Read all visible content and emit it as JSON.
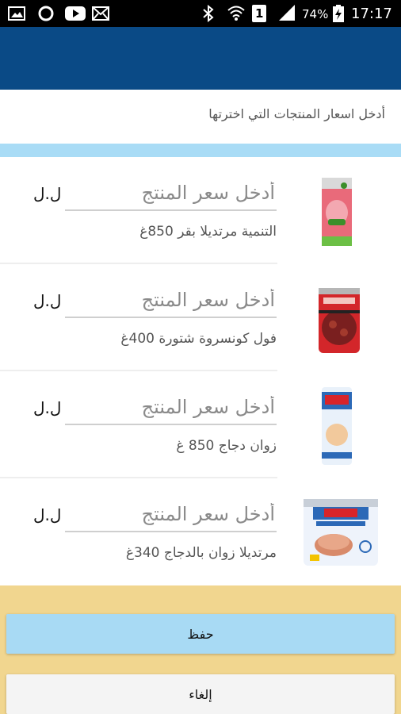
{
  "status_bar": {
    "battery": "74%",
    "time": "17:17",
    "sim": "1"
  },
  "instructions": "أدخل اسعار المنتجات التي اخترتها",
  "products": [
    {
      "name": "التنمية مرتديلا بقر 850غ",
      "placeholder": "أدخل سعر المنتج",
      "currency": "ل.ل"
    },
    {
      "name": "فول كونسروة شتورة 400غ",
      "placeholder": "أدخل سعر المنتج",
      "currency": "ل.ل"
    },
    {
      "name": "زوان دجاج 850 غ",
      "placeholder": "أدخل سعر المنتج",
      "currency": "ل.ل"
    },
    {
      "name": "مرتديلا زوان بالدجاج 340غ",
      "placeholder": "أدخل سعر المنتج",
      "currency": "ل.ل"
    }
  ],
  "buttons": {
    "save": "حفظ",
    "cancel": "إلغاء"
  },
  "colors": {
    "app_bar": "#0a4a86",
    "stripe": "#a9dcf6",
    "footer": "#f1d68f",
    "save_button": "#a8daf4"
  },
  "images": {
    "product_1": "Al Tanmia beef mortadella can",
    "product_2": "Chtoura fava beans can",
    "product_3": "Zwan chicken luncheon can",
    "product_4": "Zwan chicken luncheon meat tin"
  }
}
